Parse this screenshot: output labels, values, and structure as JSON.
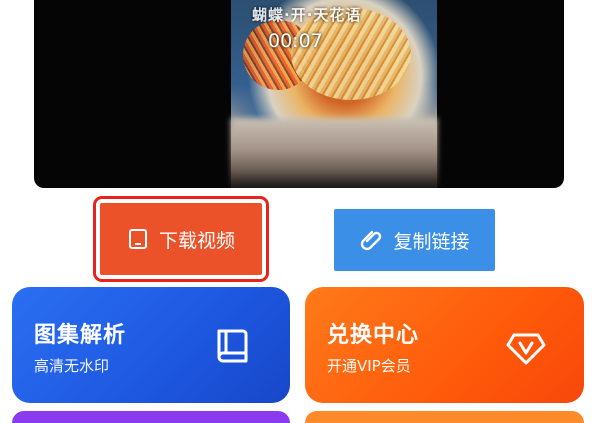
{
  "video": {
    "overlay_text": "蝴蝶·开·天花语",
    "timer": "00:07"
  },
  "actions": {
    "download_label": "下载视频",
    "copy_label": "复制链接"
  },
  "cards": {
    "gallery": {
      "title": "图集解析",
      "subtitle": "高清无水印"
    },
    "redeem": {
      "title": "兑换中心",
      "subtitle": "开通VIP会员"
    }
  },
  "icons": {
    "download": "tablet-icon",
    "copy": "paperclip-icon",
    "gallery": "book-icon",
    "redeem": "vip-gem-icon"
  },
  "colors": {
    "download_button": "#ec5229",
    "download_outline": "#e8221d",
    "copy_button": "#3b8fe6",
    "gallery_card": "#2b6ff2",
    "redeem_card": "#ff5a0a"
  }
}
